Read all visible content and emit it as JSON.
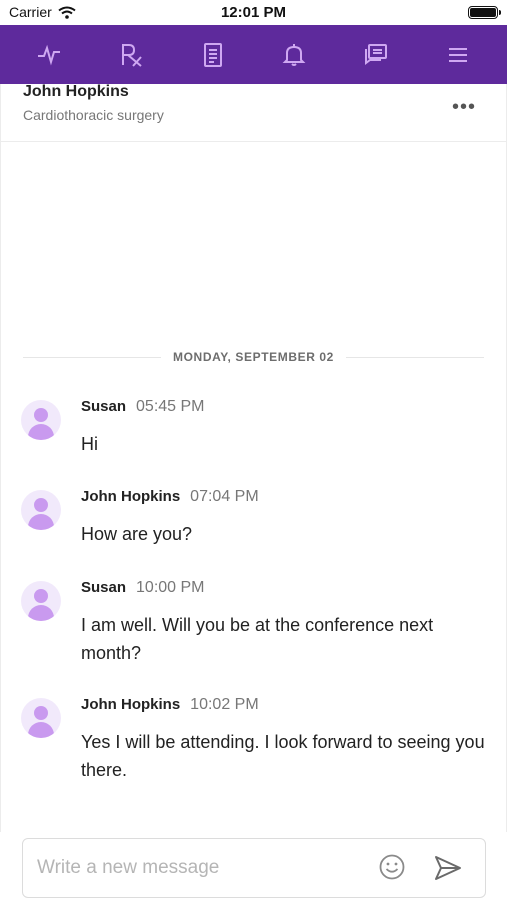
{
  "status_bar": {
    "carrier": "Carrier",
    "time": "12:01 PM"
  },
  "nav": {
    "icons": [
      "activity-icon",
      "prescription-icon",
      "document-icon",
      "bell-icon",
      "messages-icon",
      "menu-icon"
    ],
    "accent": "#5e2a9c",
    "icon_color": "#cfa8f2"
  },
  "chat_header": {
    "name": "John Hopkins",
    "subtitle": "Cardiothoracic surgery",
    "more_label": "•••"
  },
  "date_divider": "MONDAY, SEPTEMBER 02",
  "messages": [
    {
      "author": "Susan",
      "time": "05:45 PM",
      "text": "Hi"
    },
    {
      "author": "John Hopkins",
      "time": "07:04 PM",
      "text": "How are you?"
    },
    {
      "author": "Susan",
      "time": "10:00 PM",
      "text": "I am well. Will you be at the conference next month?"
    },
    {
      "author": "John Hopkins",
      "time": "10:02 PM",
      "text": "Yes I will be attending. I look forward to seeing you there."
    }
  ],
  "composer": {
    "placeholder": "Write a new message"
  }
}
